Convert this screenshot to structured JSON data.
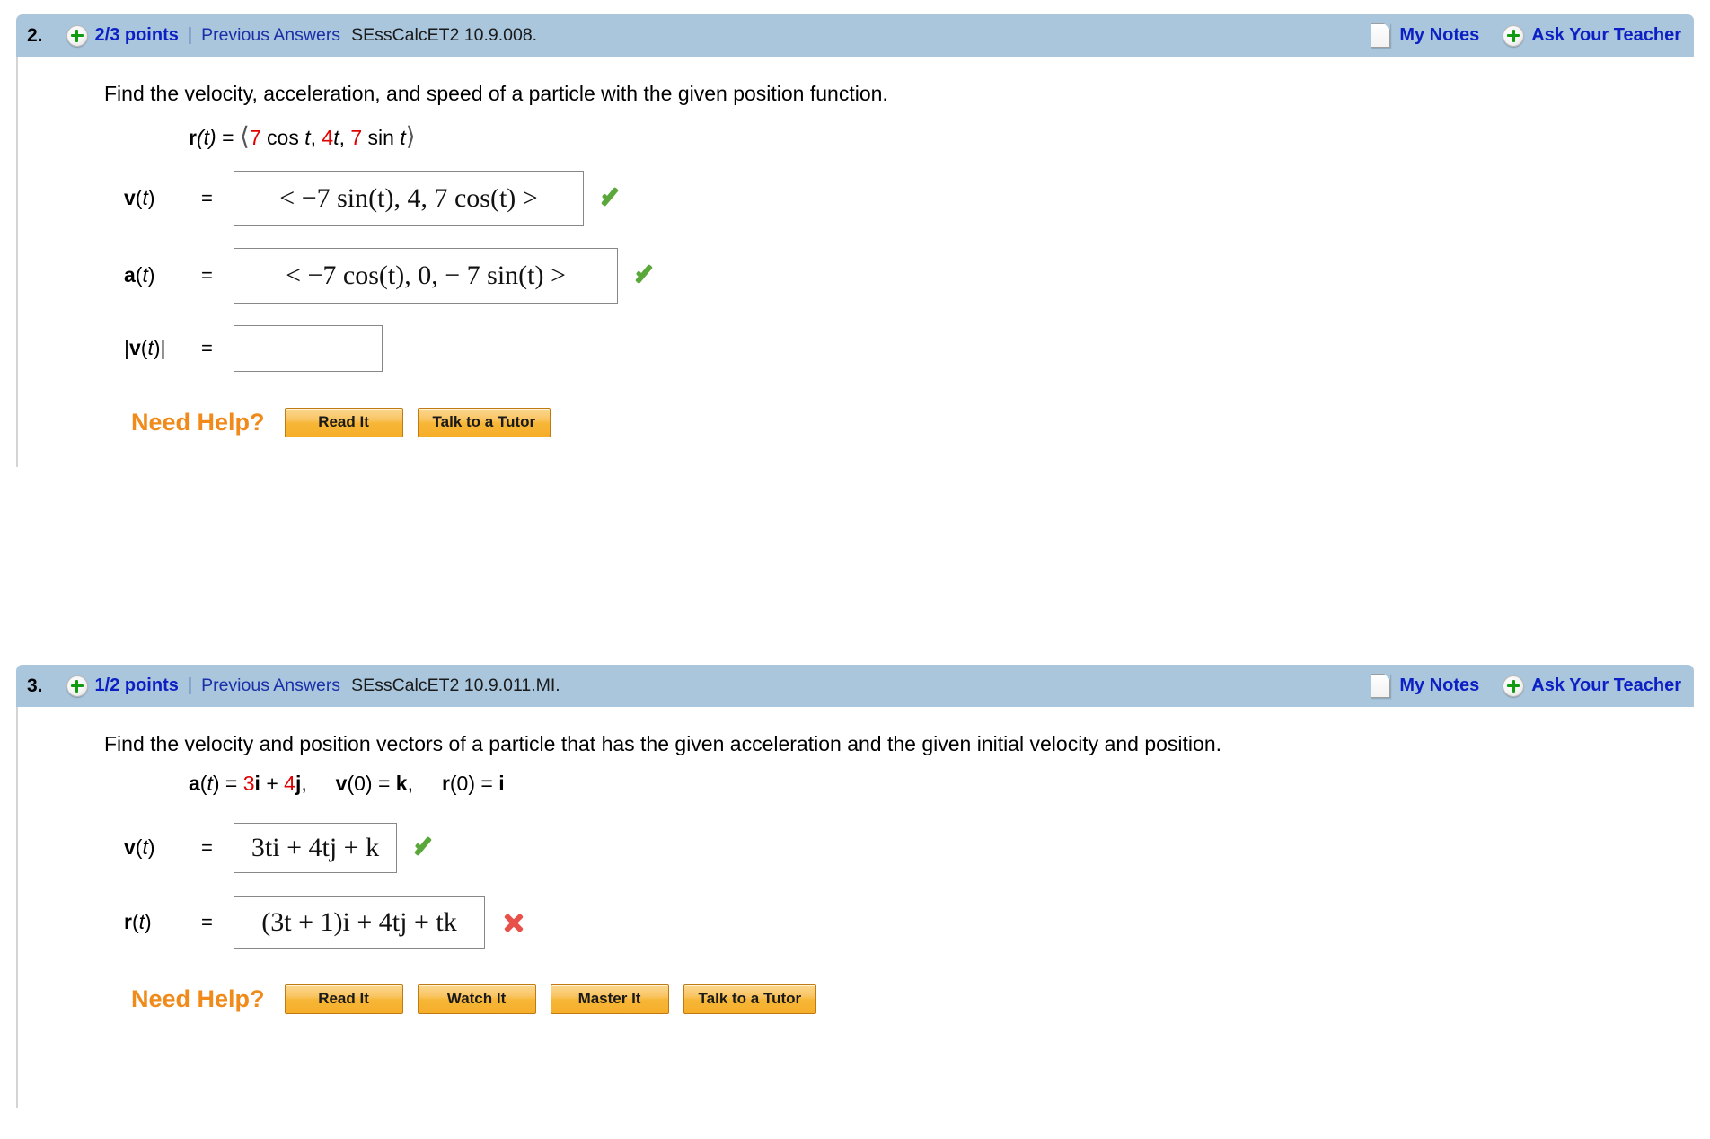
{
  "problems": [
    {
      "number": "2.",
      "points": "2/3 points",
      "divider": "|",
      "previous_answers": "Previous Answers",
      "code": "SEssCalcET2 10.9.008.",
      "my_notes": "My Notes",
      "ask_teacher": "Ask Your Teacher",
      "question": "Find the velocity, acceleration, and speed of a particle with the given position function.",
      "given": {
        "lhs": "r(t)",
        "equals": "=",
        "open": "⟨",
        "terms": [
          "7 cos t",
          "4t",
          "7 sin t"
        ],
        "close": "⟩"
      },
      "answers": [
        {
          "label": "v(t)",
          "equals": "=",
          "value": "< −7 sin(t), 4, 7 cos(t) >",
          "status": "correct"
        },
        {
          "label": "a(t)",
          "equals": "=",
          "value": "< −7 cos(t), 0, − 7 sin(t) >",
          "status": "correct"
        },
        {
          "label": "|v(t)|",
          "equals": "=",
          "value": "",
          "status": "none"
        }
      ],
      "need_help_label": "Need Help?",
      "help_buttons": [
        "Read It",
        "Talk to a Tutor"
      ]
    },
    {
      "number": "3.",
      "points": "1/2 points",
      "divider": "|",
      "previous_answers": "Previous Answers",
      "code": "SEssCalcET2 10.9.011.MI.",
      "my_notes": "My Notes",
      "ask_teacher": "Ask Your Teacher",
      "question": "Find the velocity and position vectors of a particle that has the given acceleration and the given initial velocity and position.",
      "given_line": {
        "a_lhs": "a(t)",
        "a_rhs_c1": "3",
        "a_rhs_i": "i",
        "a_plus": "+",
        "a_rhs_c2": "4",
        "a_rhs_j": "j",
        "v0": "v(0) = k,",
        "r0": "r(0) = i"
      },
      "answers": [
        {
          "label": "v(t)",
          "equals": "=",
          "value": "3ti + 4tj + k",
          "status": "correct"
        },
        {
          "label": "r(t)",
          "equals": "=",
          "value": "(3t + 1)i + 4tj + tk",
          "status": "incorrect"
        }
      ],
      "need_help_label": "Need Help?",
      "help_buttons": [
        "Read It",
        "Watch It",
        "Master It",
        "Talk to a Tutor"
      ]
    }
  ],
  "colors": {
    "header_bar": "#a9c6dd",
    "link_blue": "#0b1fc4",
    "red_value": "#e00000",
    "orange_label": "#f08a1a",
    "correct_green": "#5aa83a",
    "incorrect_red": "#e8514a"
  }
}
